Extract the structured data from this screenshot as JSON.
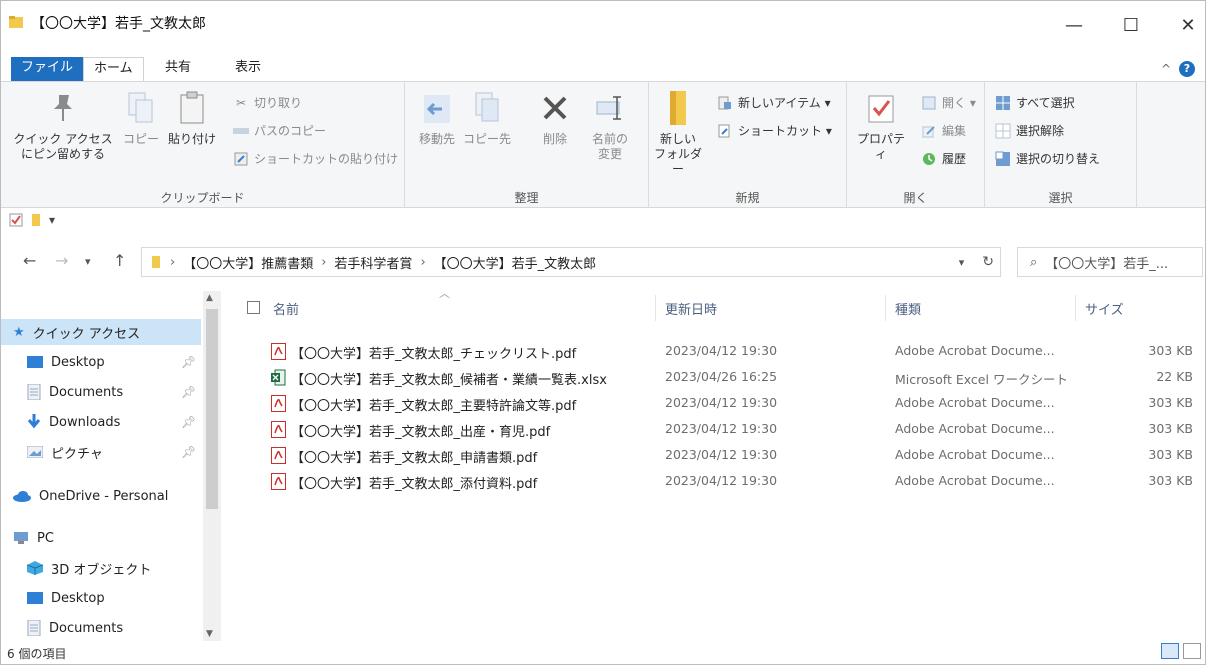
{
  "window": {
    "title": "【〇〇大学】若手_文教太郎",
    "minimize": "—",
    "maximize": "☐",
    "close": "✕"
  },
  "ribbon_tabs": {
    "file": "ファイル",
    "home": "ホーム",
    "share": "共有",
    "view": "表示",
    "collapse": "^",
    "help": "?"
  },
  "ribbon": {
    "clipboard": {
      "pin_label_1": "クイック アクセス",
      "pin_label_2": "にピン留めする",
      "copy": "コピー",
      "paste": "貼り付け",
      "cut": "切り取り",
      "copy_path": "パスのコピー",
      "paste_shortcut": "ショートカットの貼り付け",
      "group": "クリップボード"
    },
    "organize": {
      "move_to": "移動先",
      "copy_to": "コピー先",
      "delete": "削除",
      "rename_1": "名前の",
      "rename_2": "変更",
      "group": "整理"
    },
    "new": {
      "new_folder_1": "新しい",
      "new_folder_2": "フォルダー",
      "new_item": "新しいアイテム ▾",
      "shortcut": "ショートカット ▾",
      "group": "新規"
    },
    "open": {
      "properties": "プロパティ",
      "open": "開く ▾",
      "edit": "編集",
      "history": "履歴",
      "group": "開く"
    },
    "select": {
      "select_all": "すべて選択",
      "select_none": "選択解除",
      "invert": "選択の切り替え",
      "group": "選択"
    }
  },
  "address": {
    "crumbs": [
      "【〇〇大学】推薦書類",
      "若手科学者賞",
      "【〇〇大学】若手_文教太郎"
    ],
    "search_placeholder": "【〇〇大学】若手_..."
  },
  "nav_pane": {
    "quick_access": "クイック アクセス",
    "desktop": "Desktop",
    "documents": "Documents",
    "downloads": "Downloads",
    "pictures": "ピクチャ",
    "onedrive": "OneDrive - Personal",
    "pc": "PC",
    "objects3d": "3D オブジェクト",
    "desktop2": "Desktop",
    "documents2": "Documents"
  },
  "columns": {
    "name": "名前",
    "date": "更新日時",
    "type": "種類",
    "size": "サイズ"
  },
  "files": [
    {
      "name": "【〇〇大学】若手_文教太郎_チェックリスト.pdf",
      "date": "2023/04/12 19:30",
      "type": "Adobe Acrobat Docume...",
      "size": "303 KB",
      "kind": "pdf"
    },
    {
      "name": "【〇〇大学】若手_文教太郎_候補者・業績一覧表.xlsx",
      "date": "2023/04/26 16:25",
      "type": "Microsoft Excel ワークシート",
      "size": "22 KB",
      "kind": "xlsx"
    },
    {
      "name": "【〇〇大学】若手_文教太郎_主要特許論文等.pdf",
      "date": "2023/04/12 19:30",
      "type": "Adobe Acrobat Docume...",
      "size": "303 KB",
      "kind": "pdf"
    },
    {
      "name": "【〇〇大学】若手_文教太郎_出産・育児.pdf",
      "date": "2023/04/12 19:30",
      "type": "Adobe Acrobat Docume...",
      "size": "303 KB",
      "kind": "pdf"
    },
    {
      "name": "【〇〇大学】若手_文教太郎_申請書類.pdf",
      "date": "2023/04/12 19:30",
      "type": "Adobe Acrobat Docume...",
      "size": "303 KB",
      "kind": "pdf"
    },
    {
      "name": "【〇〇大学】若手_文教太郎_添付資料.pdf",
      "date": "2023/04/12 19:30",
      "type": "Adobe Acrobat Docume...",
      "size": "303 KB",
      "kind": "pdf"
    }
  ],
  "status": {
    "count": "6 個の項目"
  },
  "colors": {
    "accent": "#1f6fc0",
    "selection": "#cce4f7",
    "folder": "#f2c94c"
  }
}
